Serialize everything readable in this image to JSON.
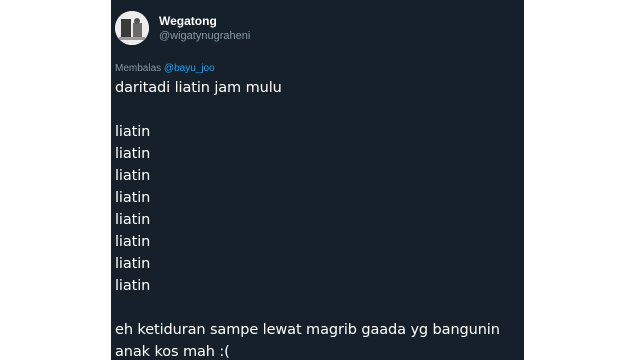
{
  "tweet": {
    "display_name": "Wegatong",
    "handle": "@wigatynugraheni",
    "reply_prefix": "Membalas",
    "reply_mention": "@bayu_joo",
    "lines": [
      "daritadi liatin jam mulu",
      "",
      "liatin",
      "liatin",
      "liatin",
      "liatin",
      "liatin",
      "liatin",
      "liatin",
      "liatin",
      "",
      "eh ketiduran sampe lewat magrib gaada yg bangunin",
      "anak kos mah :("
    ]
  },
  "colors": {
    "background": "#15202b",
    "text": "#ffffff",
    "secondary": "#8899a6",
    "link": "#1da1f2"
  }
}
